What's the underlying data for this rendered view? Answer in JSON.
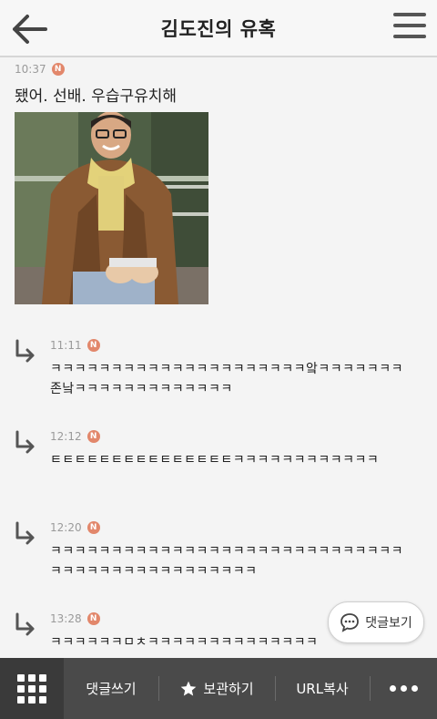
{
  "header": {
    "title": "김도진의 유혹",
    "back_icon": "back-arrow-icon",
    "menu_icon": "hamburger-menu-icon"
  },
  "post": {
    "time": "10:37",
    "badge": "N",
    "text": "됐어. 선배. 우습구유치해",
    "image_alt": "photo-man-in-brown-coat"
  },
  "comments": [
    {
      "time": "11:11",
      "badge": "N",
      "text": "ㅋㅋㅋㅋㅋㅋㅋㅋㅋㅋㅋㅋㅋㅋㅋㅋㅋㅋㅋㅋㅋ앜ㅋㅋㅋㅋㅋㅋㅋ존낰ㅋㅋㅋㅋㅋㅋㅋㅋㅋㅋㅋㅋㅋ"
    },
    {
      "time": "12:12",
      "badge": "N",
      "text": "ㅌㅌㅌㅌㅌㅌㅌㅌㅌㅌㅌㅌㅌㅌㅌㅋㅋㅋㅋㅋㅋㅋㅋㅋㅋㅋㅋ"
    },
    {
      "time": "12:20",
      "badge": "N",
      "text": "ㅋㅋㅋㅋㅋㅋㅋㅋㅋㅋㅋㅋㅋㅋㅋㅋㅋㅋㅋㅋㅋㅋㅋㅋㅋㅋㅋㅋㅋㅋㅋㅋㅋㅋㅋㅋㅋㅋㅋㅋㅋㅋㅋㅋㅋㅋ"
    },
    {
      "time": "13:28",
      "badge": "N",
      "text": "ㅋㅋㅋㅋㅋㅋㅁㅊㅋㅋㅋㅋㅋㅋㅋㅋㅋㅋㅋㅋㅋㅋ"
    }
  ],
  "floating": {
    "view_comments": "댓글보기",
    "icon": "chat-bubble-icon"
  },
  "bottom_bar": {
    "grid_icon": "grid-menu-icon",
    "write_comment": "댓글쓰기",
    "save": "보관하기",
    "save_icon": "star-icon",
    "copy_url": "URL복사",
    "more_icon": "more-dots-icon"
  },
  "colors": {
    "badge": "#e2876b",
    "bottom_bar": "#4a4a4a",
    "grid_button": "#3a3a3a"
  }
}
